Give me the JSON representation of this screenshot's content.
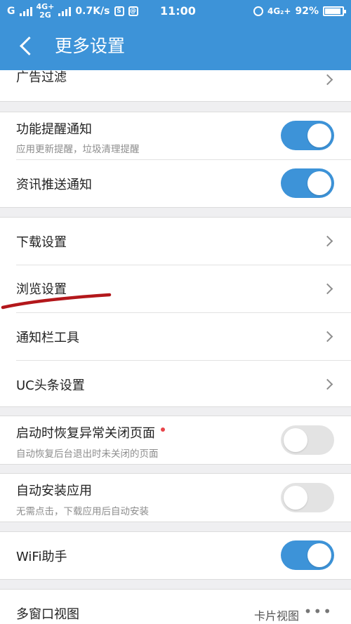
{
  "status_bar": {
    "network1": "G",
    "network2_top": "4G+",
    "network2_bottom": "2G",
    "speed": "0.7K/s",
    "icon1": "S",
    "icon2": "@",
    "time": "11:00",
    "network3": "4G₂+",
    "battery": "92%",
    "battery_level": 0.92
  },
  "header": {
    "title": "更多设置"
  },
  "items": {
    "ad_filter": {
      "label": "广告过滤"
    },
    "feature_notify": {
      "label": "功能提醒通知",
      "sub": "应用更新提醒，垃圾清理提醒",
      "on": true
    },
    "news_push": {
      "label": "资讯推送通知",
      "on": true
    },
    "download": {
      "label": "下载设置"
    },
    "browse": {
      "label": "浏览设置"
    },
    "notif_tools": {
      "label": "通知栏工具"
    },
    "uc_headlines": {
      "label": "UC头条设置"
    },
    "restore_pages": {
      "label": "启动时恢复异常关闭页面",
      "sub": "自动恢复后台退出时未关闭的页面",
      "on": false
    },
    "auto_install": {
      "label": "自动安装应用",
      "sub": "无需点击，下载应用后自动安装",
      "on": false
    },
    "wifi_helper": {
      "label": "WiFi助手",
      "on": true
    },
    "multi_window": {
      "label": "多窗口视图",
      "value": "卡片视图",
      "more": "•••"
    }
  },
  "colors": {
    "accent": "#3d93d8",
    "annotation": "#b3171b"
  }
}
